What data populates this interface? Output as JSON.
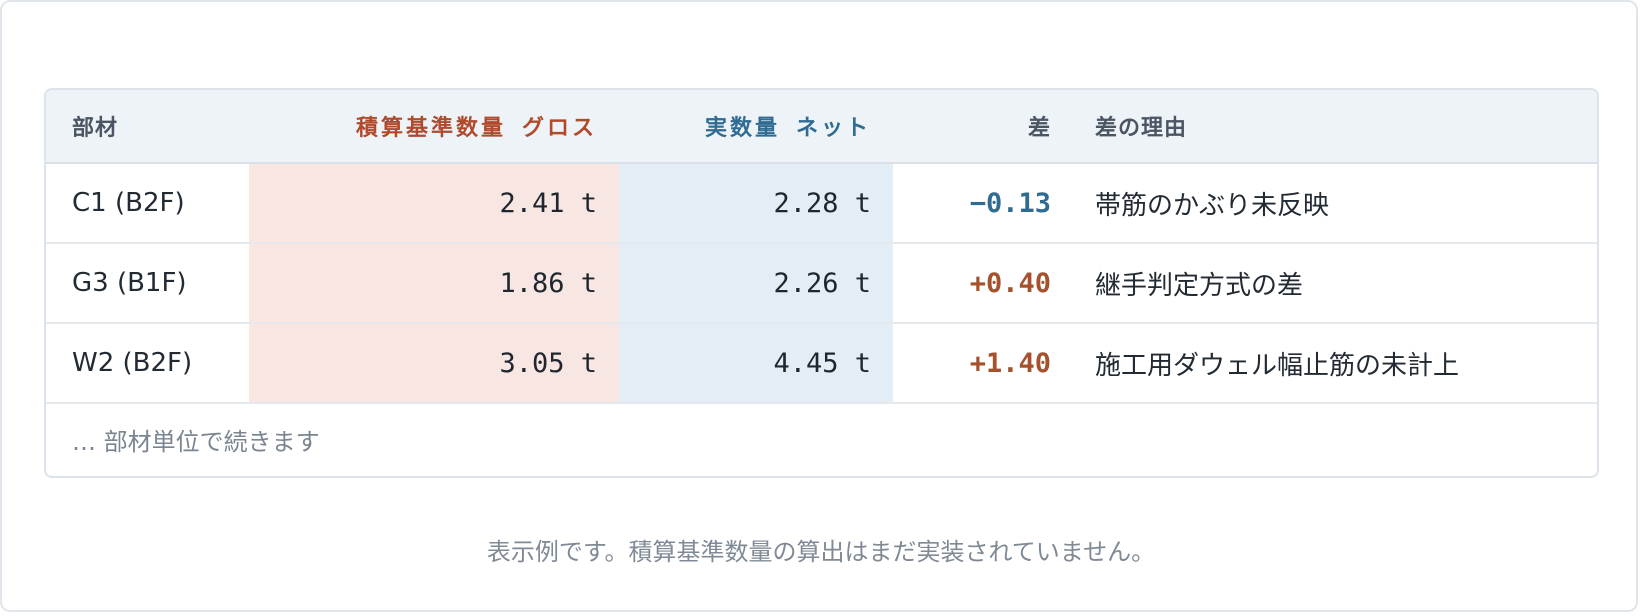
{
  "table": {
    "headers": {
      "part": "部材",
      "gross_main": "積算基準数量",
      "gross_sub": "グロス",
      "net_main": "実数量",
      "net_sub": "ネット",
      "diff": "差",
      "reason": "差の理由"
    },
    "rows": [
      {
        "part": "C1 (B2F)",
        "gross": "2.41 t",
        "net": "2.28 t",
        "diff": "−0.13",
        "diff_sign": "negative",
        "reason": "帯筋のかぶり未反映"
      },
      {
        "part": "G3 (B1F)",
        "gross": "1.86 t",
        "net": "2.26 t",
        "diff": "+0.40",
        "diff_sign": "positive",
        "reason": "継手判定方式の差"
      },
      {
        "part": "W2 (B2F)",
        "gross": "3.05 t",
        "net": "4.45 t",
        "diff": "+1.40",
        "diff_sign": "positive",
        "reason": "施工用ダウェル幅止筋の未計上"
      }
    ],
    "more": "… 部材単位で続きます"
  },
  "footnote": "表示例です。積算基準数量の算出はまだ実装されていません。",
  "colors": {
    "gross_accent": "#b04a2c",
    "net_accent": "#2f6b93",
    "gross_fill": "#f7e6e1",
    "net_fill": "#e3edf5",
    "negative": "#2f6b93",
    "positive": "#a5512d"
  }
}
